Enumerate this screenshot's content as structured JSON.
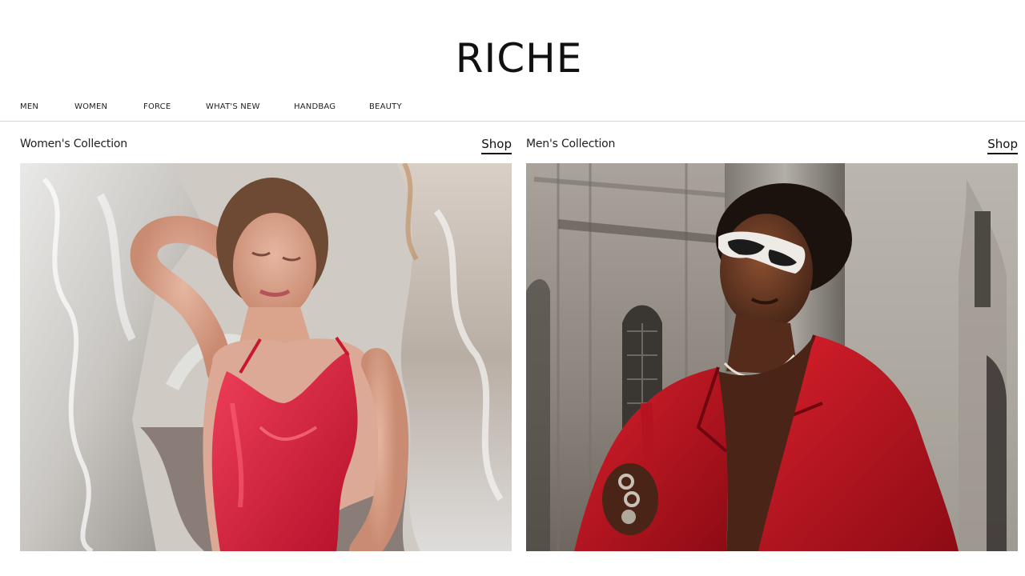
{
  "brand": {
    "logo_text": "RICHE"
  },
  "nav": {
    "items": [
      {
        "label": "MEN"
      },
      {
        "label": "WOMEN"
      },
      {
        "label": "FORCE"
      },
      {
        "label": "WHAT'S NEW"
      },
      {
        "label": "HANDBAG"
      },
      {
        "label": "BEAUTY"
      }
    ]
  },
  "collections": [
    {
      "title": "Women's Collection",
      "cta": "Shop"
    },
    {
      "title": "Men's Collection",
      "cta": "Shop"
    }
  ]
}
